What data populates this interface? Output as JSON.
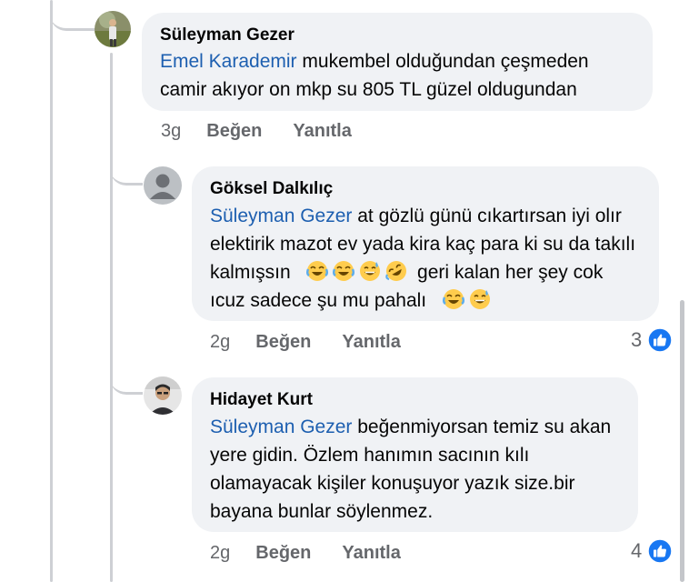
{
  "comments": [
    {
      "author": "Süleyman Gezer",
      "mention": "Emel Karademir",
      "text": "mukembel olduğundan çeşmeden camir akıyor on mkp su 805 TL güzel oldugundan",
      "time": "3g",
      "like_label": "Beğen",
      "reply_label": "Yanıtla"
    },
    {
      "author": "Göksel Dalkılıç",
      "mention": "Süleyman Gezer",
      "text_part1": " at gözlü günü cıkartırsan iyi olır elektirik mazot ev yada kira kaç para ki su da takılı kalmışsın",
      "text_part2": "geri kalan her şey cok ıcuz sadece şu mu pahalı",
      "emojis_mid": [
        "face-with-tears-of-joy",
        "face-with-tears-of-joy",
        "grinning-face-with-sweat",
        "rolling-on-the-floor-laughing"
      ],
      "emojis_end": [
        "face-with-tears-of-joy",
        "grinning-face-with-sweat"
      ],
      "time": "2g",
      "like_label": "Beğen",
      "reply_label": "Yanıtla",
      "reaction_count": "3",
      "reaction_icon": "like-icon"
    },
    {
      "author": "Hidayet Kurt",
      "mention": "Süleyman Gezer",
      "text": " beğenmiyorsan  temiz su akan yere gidin. Özlem hanımın sacının kılı olamayacak kişiler  konuşuyor yazık size.bir bayana bunlar söylenmez.",
      "time": "2g",
      "like_label": "Beğen",
      "reply_label": "Yanıtla",
      "reaction_count": "4",
      "reaction_icon": "like-icon"
    }
  ],
  "colors": {
    "bubble_bg": "#f0f2f5",
    "mention": "#1d5fb0",
    "meta": "#65676b",
    "like_blue": "#1877f2",
    "thread_line": "#ced0d4"
  }
}
